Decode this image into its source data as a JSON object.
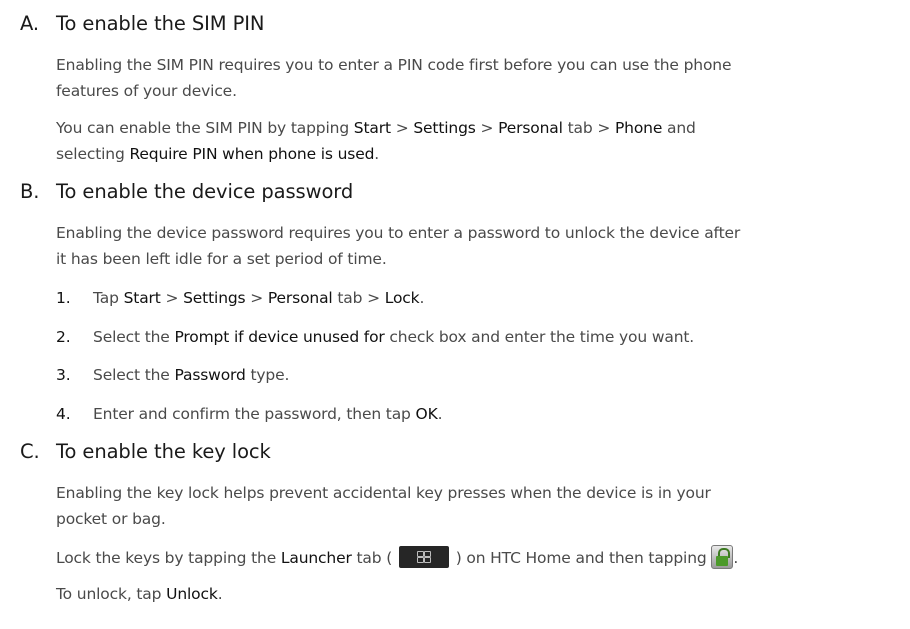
{
  "sections": [
    {
      "letter": "A.",
      "title": "To enable the SIM PIN",
      "intro_lines": [
        "Enabling the SIM PIN requires you to enter a PIN code first before you can use the phone",
        "features of your device."
      ],
      "para2_parts": [
        "You can enable the SIM PIN by tapping ",
        "Start",
        " > ",
        "Settings",
        " > ",
        "Personal",
        " tab > ",
        "Phone",
        " and"
      ],
      "para3_parts": [
        "selecting ",
        "Require PIN when phone is used",
        "."
      ]
    },
    {
      "letter": "B.",
      "title": "To enable the device password",
      "intro_lines": [
        "Enabling the device password requires you to enter a password to unlock the device after",
        "it has been left idle for a set period of time."
      ],
      "steps": [
        {
          "num": "1.",
          "parts": [
            "Tap ",
            "Start",
            " > ",
            "Settings",
            " > ",
            "Personal",
            " tab > ",
            "Lock",
            "."
          ]
        },
        {
          "num": "2.",
          "parts": [
            "Select the ",
            "Prompt if device unused for",
            " check box and enter the time you want."
          ]
        },
        {
          "num": "3.",
          "parts": [
            "Select the ",
            "Password",
            " type."
          ]
        },
        {
          "num": "4.",
          "parts": [
            "Enter and confirm the password, then tap ",
            "OK",
            "."
          ]
        }
      ]
    },
    {
      "letter": "C.",
      "title": "To enable the key lock",
      "intro_lines": [
        "Enabling the key lock helps prevent accidental key presses when the device is in your",
        "pocket or bag."
      ],
      "lock_parts": [
        "Lock the keys by tapping the ",
        "Launcher",
        " tab ( ",
        " ) on HTC Home and then tapping ",
        "."
      ],
      "unlock_parts": [
        "To unlock, tap ",
        "Unlock",
        "."
      ]
    }
  ],
  "icons": {
    "launcher": "launcher-tab-icon",
    "lock": "lock-icon"
  }
}
